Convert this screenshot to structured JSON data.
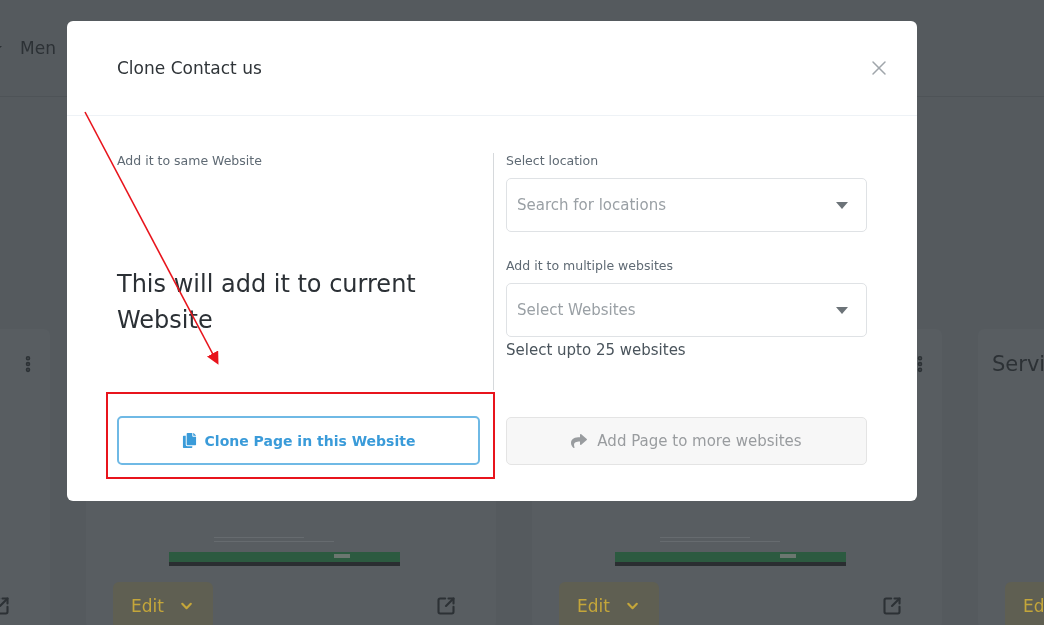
{
  "background": {
    "nav_item": "Men",
    "cards": [
      {
        "kind": "edge"
      },
      {
        "kind": "covered",
        "edit": "Edit"
      },
      {
        "kind": "covered_menu",
        "edit": "Edit"
      },
      {
        "kind": "cut",
        "title": "Servi",
        "edit": "Ed"
      }
    ]
  },
  "dialog": {
    "title": "Clone Contact us",
    "left": {
      "label": "Add it to same Website",
      "message": "This will add it to current Website",
      "button": {
        "label": "Clone Page in this Website",
        "disabled": false
      }
    },
    "right": {
      "fields": [
        {
          "label": "Select location",
          "placeholder": "Search for locations"
        },
        {
          "label": "Add it to multiple websites",
          "placeholder": "Select Websites",
          "help": "Select upto 25 websites"
        }
      ],
      "button": {
        "label": "Add Page to more websites",
        "disabled": true
      }
    }
  }
}
